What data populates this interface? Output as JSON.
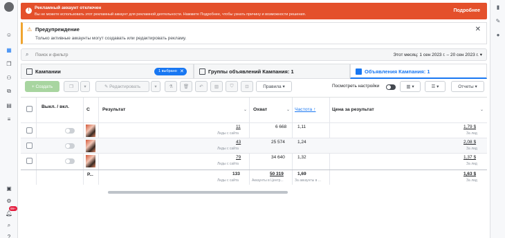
{
  "banner": {
    "title": "Рекламный аккаунт отключен",
    "text": "Вы не можете использовать этот рекламный аккаунт для рекламной деятельности. Нажмите Подробнее, чтобы узнать причину и возможности решения.",
    "more_label": "Подробнее",
    "color": "#e4502b"
  },
  "alert": {
    "title": "Предупреждение",
    "text": "Только активные аккаунты могут создавать или редактировать рекламу.",
    "close": "✕"
  },
  "search": {
    "placeholder": "Поиск и фильтр",
    "date_range": "Этот месяц: 1 сен 2023 г. – 20 сен 2023 г."
  },
  "tabs": {
    "campaigns": "Кампании",
    "selected_pill": "1 выбрано",
    "adsets": "Группы объявлений Кампания: 1",
    "ads": "Объявления Кампания: 1"
  },
  "toolbar": {
    "create": "+ Создать",
    "edit": "Редактировать",
    "rules": "Правила",
    "view_settings": "Посмотреть настройки",
    "reports": "Отчеты"
  },
  "table": {
    "headers": {
      "toggle": "Выкл. / вкл.",
      "ad": "С",
      "result": "Результат",
      "reach": "Охват",
      "frequency": "Частота ↑",
      "cost": "Цена за результат"
    },
    "rows": [
      {
        "result": "11",
        "result_sub": "Лиды с сайта",
        "reach": "6 668",
        "frequency": "1,11",
        "cost": "1,79 $",
        "cost_sub": "За лид"
      },
      {
        "result": "43",
        "result_sub": "Лиды с сайта",
        "reach": "25 574",
        "frequency": "1,24",
        "cost": "2,08 $",
        "cost_sub": "За лид"
      },
      {
        "result": "79",
        "result_sub": "Лиды с сайта",
        "reach": "34 640",
        "frequency": "1,32",
        "cost": "1,37 $",
        "cost_sub": "За лид"
      }
    ],
    "total": {
      "label": "Р...",
      "result": "133",
      "result_sub": "Лиды с сайта",
      "reach": "50 319",
      "reach_sub": "Аккаунты в Центр...",
      "frequency": "1,69",
      "frequency_sub": "За аккаунты в ...",
      "cost": "1,63 $",
      "cost_sub": "За лид"
    }
  },
  "leftbar": {
    "notification_badge": "99+"
  },
  "icons": [
    "settings-icon",
    "campaigns-icon",
    "pages-icon",
    "audience-icon",
    "catalog-icon",
    "billing-icon",
    "menu-icon",
    "gallery-icon",
    "gear-icon",
    "bell-icon",
    "search-icon",
    "help-icon",
    "chart-icon",
    "pencil-icon"
  ]
}
